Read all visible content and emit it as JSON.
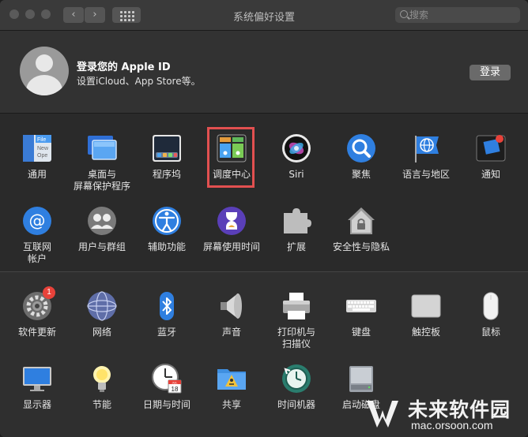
{
  "window": {
    "title": "系统偏好设置"
  },
  "toolbar": {
    "back_label": "‹",
    "forward_label": "›"
  },
  "search": {
    "placeholder": "搜索"
  },
  "account": {
    "title": "登录您的 Apple ID",
    "subtitle": "设置iCloud、App Store等。",
    "login_button": "登录"
  },
  "prefs_row1": [
    {
      "label": "通用",
      "icon": "general-icon"
    },
    {
      "label": "桌面与\n屏幕保护程序",
      "icon": "desktop-screensaver-icon"
    },
    {
      "label": "程序坞",
      "icon": "dock-icon"
    },
    {
      "label": "调度中心",
      "icon": "mission-control-icon"
    },
    {
      "label": "Siri",
      "icon": "siri-icon"
    },
    {
      "label": "聚焦",
      "icon": "spotlight-icon"
    },
    {
      "label": "语言与地区",
      "icon": "language-region-icon"
    },
    {
      "label": "通知",
      "icon": "notifications-icon"
    }
  ],
  "prefs_row2": [
    {
      "label": "互联网\n帐户",
      "icon": "internet-accounts-icon"
    },
    {
      "label": "用户与群组",
      "icon": "users-groups-icon"
    },
    {
      "label": "辅助功能",
      "icon": "accessibility-icon"
    },
    {
      "label": "屏幕使用时间",
      "icon": "screen-time-icon"
    },
    {
      "label": "扩展",
      "icon": "extensions-icon"
    },
    {
      "label": "安全性与隐私",
      "icon": "security-privacy-icon"
    }
  ],
  "prefs_row3": [
    {
      "label": "软件更新",
      "icon": "software-update-icon",
      "badge": "1"
    },
    {
      "label": "网络",
      "icon": "network-icon"
    },
    {
      "label": "蓝牙",
      "icon": "bluetooth-icon"
    },
    {
      "label": "声音",
      "icon": "sound-icon"
    },
    {
      "label": "打印机与\n扫描仪",
      "icon": "printers-scanners-icon"
    },
    {
      "label": "键盘",
      "icon": "keyboard-icon"
    },
    {
      "label": "触控板",
      "icon": "trackpad-icon"
    },
    {
      "label": "鼠标",
      "icon": "mouse-icon"
    }
  ],
  "prefs_row4": [
    {
      "label": "显示器",
      "icon": "displays-icon"
    },
    {
      "label": "节能",
      "icon": "energy-saver-icon"
    },
    {
      "label": "日期与时间",
      "icon": "date-time-icon",
      "calendar_month": "JUL",
      "calendar_day": "18"
    },
    {
      "label": "共享",
      "icon": "sharing-icon"
    },
    {
      "label": "时间机器",
      "icon": "time-machine-icon"
    },
    {
      "label": "启动磁盘",
      "icon": "startup-disk-icon"
    }
  ],
  "watermark": {
    "title": "未来软件园",
    "url": "mac.orsoon.com"
  },
  "colors": {
    "highlight": "#e25050",
    "badge": "#e8423a",
    "accent": "#2f8bff"
  }
}
